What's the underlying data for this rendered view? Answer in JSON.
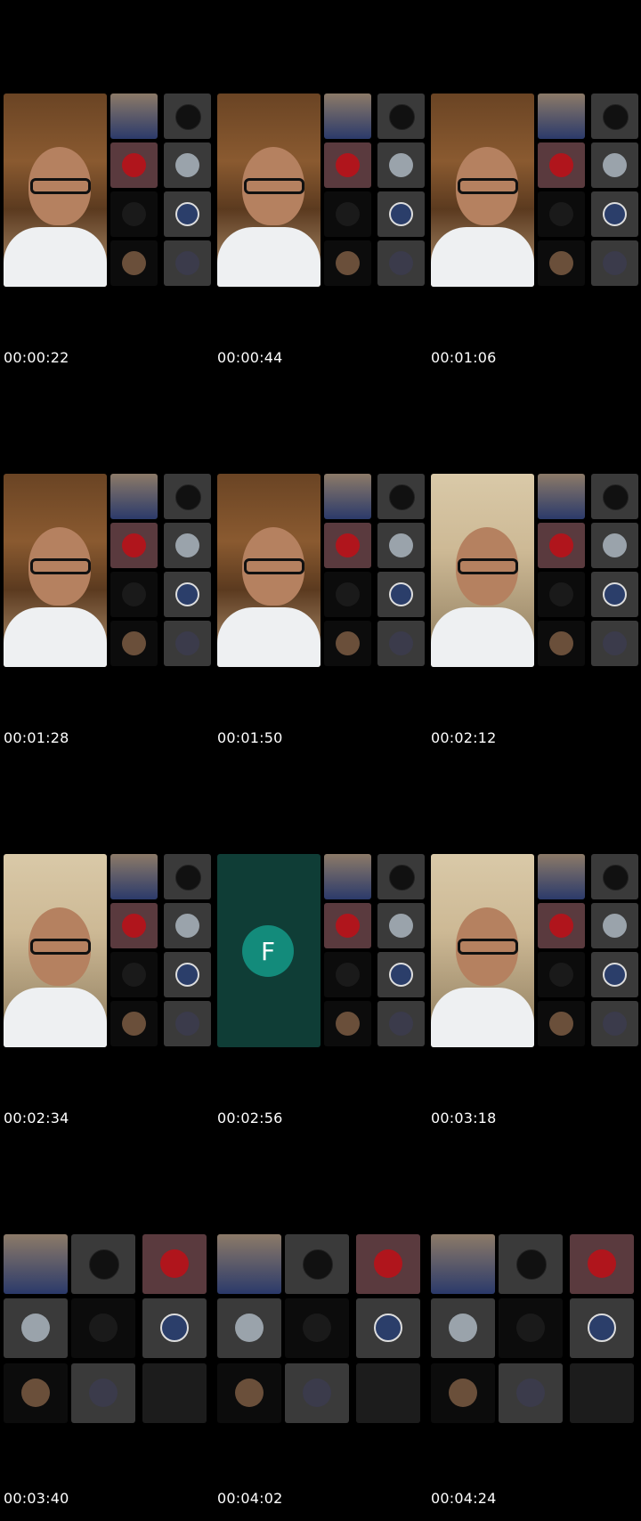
{
  "frames": [
    {
      "timestamp": "00:00:22",
      "layout": "speaker"
    },
    {
      "timestamp": "00:00:44",
      "layout": "speaker"
    },
    {
      "timestamp": "00:01:06",
      "layout": "speaker"
    },
    {
      "timestamp": "00:01:28",
      "layout": "speaker"
    },
    {
      "timestamp": "00:01:50",
      "layout": "speaker"
    },
    {
      "timestamp": "00:02:12",
      "layout": "speaker"
    },
    {
      "timestamp": "00:02:34",
      "layout": "speaker"
    },
    {
      "timestamp": "00:02:56",
      "layout": "avatar",
      "avatar_letter": "F"
    },
    {
      "timestamp": "00:03:18",
      "layout": "speaker"
    },
    {
      "timestamp": "00:03:40",
      "layout": "grid"
    },
    {
      "timestamp": "00:04:02",
      "layout": "grid"
    },
    {
      "timestamp": "00:04:24",
      "layout": "grid"
    }
  ],
  "colors": {
    "background": "#000000",
    "avatar_bg": "#0f3d36",
    "avatar_circle": "#138b7b",
    "text": "#ffffff"
  }
}
